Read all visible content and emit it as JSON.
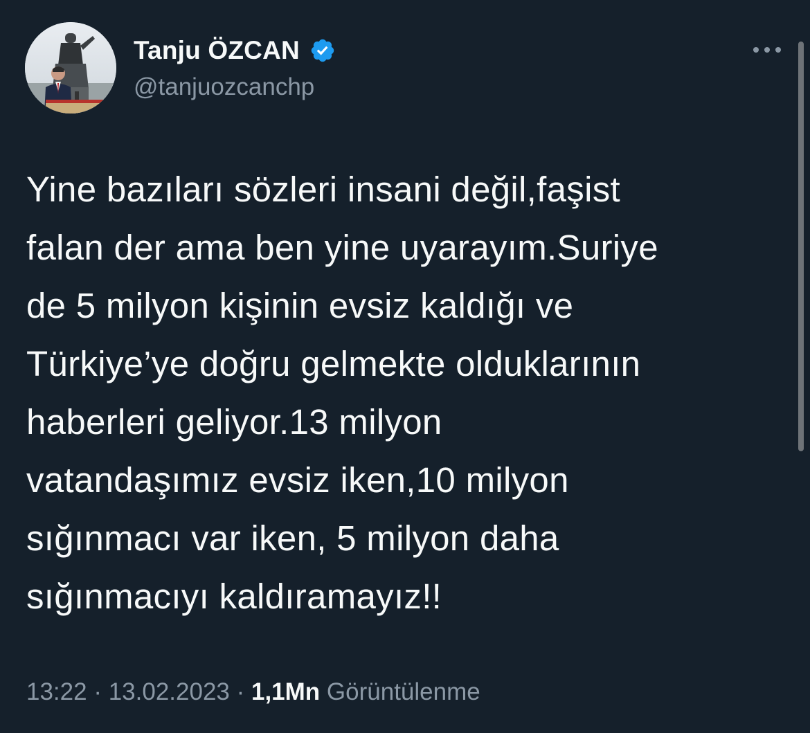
{
  "author": {
    "display_name": "Tanju ÖZCAN",
    "handle": "@tanjuozcanchp",
    "verified": true,
    "verified_color": "#1d9bf0",
    "avatar_icon": "profile-photo-speaker-at-podium"
  },
  "more_icon": "more-dots-icon",
  "tweet": {
    "lines": [
      "Yine bazıları sözleri insani değil,faşist",
      "falan der ama ben yine uyarayım.Suriye",
      "de 5 milyon kişinin evsiz kaldığı ve",
      "Türkiye’ye doğru gelmekte olduklarının",
      "haberleri geliyor.13 milyon",
      "vatandaşımız evsiz iken,10 milyon",
      "sığınmacı var iken, 5 milyon daha",
      "sığınmacıyı kaldıramayız!!"
    ]
  },
  "meta": {
    "time": "13:22",
    "separator": " · ",
    "date": "13.02.2023",
    "views_count": "1,1Mn",
    "views_label": "Görüntülenme"
  },
  "colors": {
    "background": "#15202b",
    "primary_text": "#f7f9f9",
    "secondary_text": "#8b98a5",
    "accent": "#1d9bf0"
  }
}
